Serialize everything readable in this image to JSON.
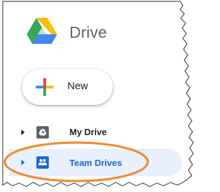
{
  "app": {
    "title": "Drive",
    "logo_icon": "google-drive-logo-icon"
  },
  "new_button": {
    "label": "New",
    "icon": "plus-icon",
    "icon_colors": [
      "#4285f4",
      "#ea4335",
      "#fbbc04",
      "#34a853"
    ]
  },
  "nav": {
    "items": [
      {
        "label": "My Drive",
        "icon": "my-drive-icon",
        "expand_icon": "expand-arrow-icon",
        "active": false
      },
      {
        "label": "Team Drives",
        "icon": "team-drives-icon",
        "expand_icon": "expand-arrow-icon",
        "active": true
      }
    ]
  },
  "colors": {
    "active_text": "#1967d2",
    "active_background": "#e8f0fe",
    "annotation_ellipse": "#f28a2e",
    "title_gray": "#5f6368"
  }
}
